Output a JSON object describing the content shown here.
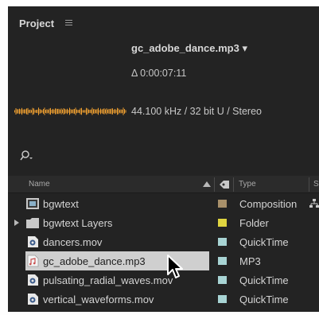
{
  "panel": {
    "title": "Project",
    "menu_icon": "hamburger-menu-icon"
  },
  "preview": {
    "file_name": "gc_adobe_dance.mp3 ▾",
    "duration": "Δ 0:00:07:11",
    "audio_info": "44.100 kHz / 32 bit U / Stereo",
    "waveform_color": "#f0a030"
  },
  "search": {
    "icon": "search-icon"
  },
  "columns": {
    "name": "Name",
    "type": "Type",
    "extra": "S",
    "label_icon": "label-tag-icon"
  },
  "items": [
    {
      "name": "bgwtext",
      "type": "Composition",
      "icon": "composition-icon",
      "label_color": "#a8906a",
      "expandable": false,
      "selected": false,
      "extra_icon": "flowchart-icon"
    },
    {
      "name": "bgwtext Layers",
      "type": "Folder",
      "icon": "folder-icon",
      "label_color": "#e0d540",
      "expandable": true,
      "selected": false
    },
    {
      "name": "dancers.mov",
      "type": "QuickTime",
      "icon": "quicktime-file-icon",
      "label_color": "#a8d4d4",
      "expandable": false,
      "selected": false
    },
    {
      "name": "gc_adobe_dance.mp3",
      "type": "MP3",
      "icon": "audio-file-icon",
      "label_color": "#a8d4d4",
      "expandable": false,
      "selected": true
    },
    {
      "name": "pulsating_radial_waves.mov",
      "type": "QuickTime",
      "icon": "quicktime-file-icon",
      "label_color": "#a8d4d4",
      "expandable": false,
      "selected": false
    },
    {
      "name": "vertical_waveforms.mov",
      "type": "QuickTime",
      "icon": "quicktime-file-icon",
      "label_color": "#a8d4d4",
      "expandable": false,
      "selected": false
    }
  ]
}
